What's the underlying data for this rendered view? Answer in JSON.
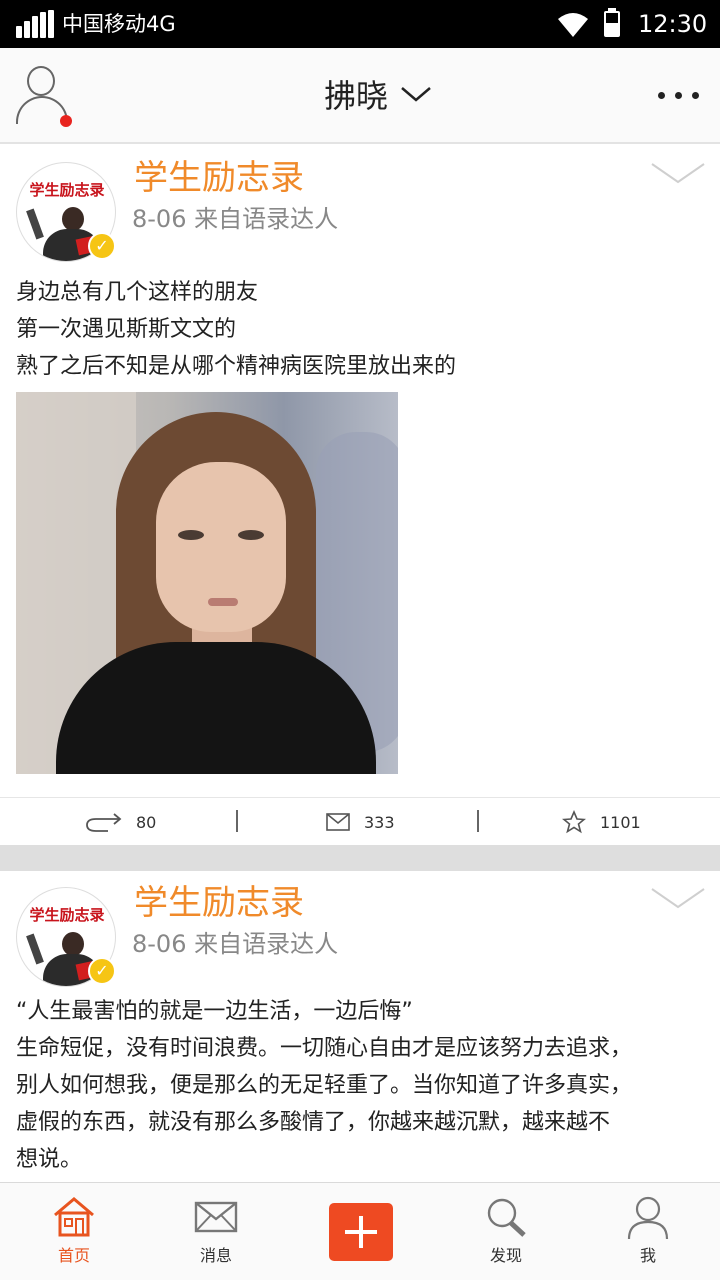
{
  "status_bar": {
    "carrier": "中国移动4G",
    "time": "12:30"
  },
  "header": {
    "title": "拂晓"
  },
  "posts": [
    {
      "author": "学生励志录",
      "avatar_text": "学生励志录",
      "meta": "8-06 来自语录达人",
      "lines": [
        "身边总有几个这样的朋友",
        "第一次遇见斯斯文文的",
        "熟了之后不知是从哪个精神病医院里放出来的"
      ],
      "reposts": "80",
      "comments": "333",
      "likes": "1101"
    },
    {
      "author": "学生励志录",
      "avatar_text": "学生励志录",
      "meta": "8-06 来自语录达人",
      "quote": "“人生最害怕的就是一边生活，一边后悔”",
      "lines": [
        "生命短促，没有时间浪费。一切随心自由才是应该努力去追求，",
        "别人如何想我，便是那么的无足轻重了。当你知道了许多真实，",
        "虚假的东西，就没有那么多酸情了，你越来越沉默，越来越不",
        "想说。"
      ]
    }
  ],
  "bottom_nav": {
    "home": "首页",
    "messages": "消息",
    "discover": "发现",
    "me": "我"
  },
  "colors": {
    "accent": "#ee4a22",
    "author": "#f08a2a",
    "badge": "#f6c514",
    "notification_dot": "#e8241f"
  },
  "icons": [
    "signal-icon",
    "wifi-icon",
    "battery-icon",
    "profile-icon",
    "chevron-down-icon",
    "more-icon",
    "verified-icon",
    "repost-icon",
    "comment-icon",
    "star-icon",
    "home-icon",
    "mail-icon",
    "plus-icon",
    "search-icon",
    "user-icon"
  ]
}
